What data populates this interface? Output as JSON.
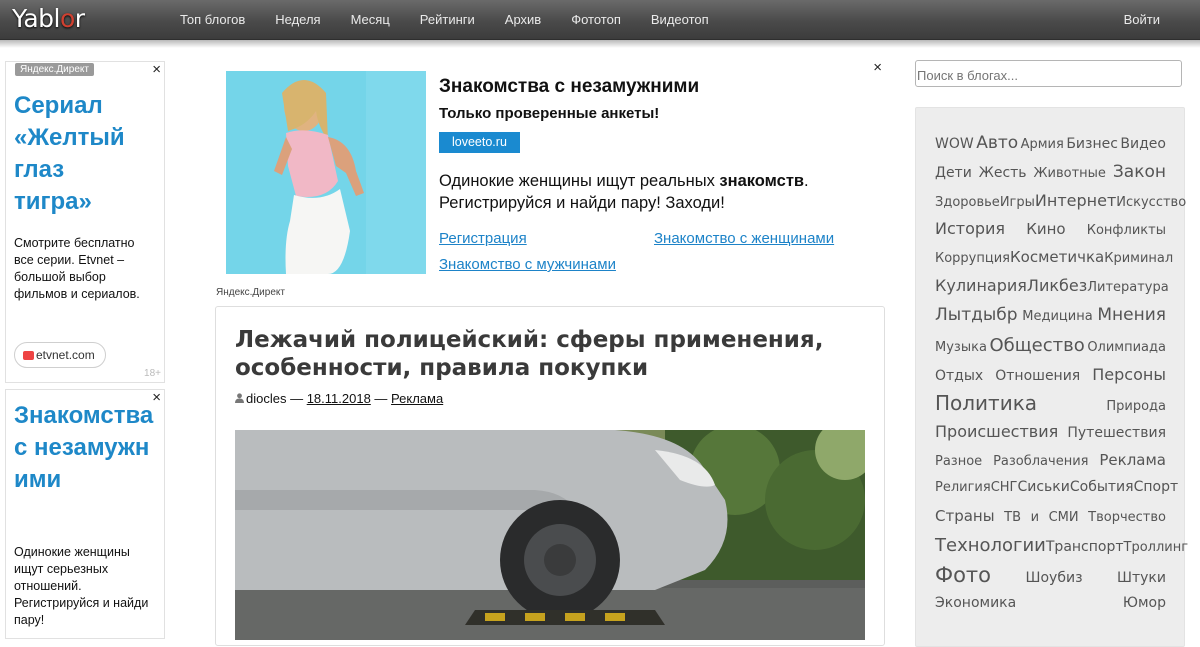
{
  "header": {
    "logo": "Yablor",
    "nav": [
      "Топ блогов",
      "Неделя",
      "Месяц",
      "Рейтинги",
      "Архив",
      "Фототоп",
      "Видеотоп"
    ],
    "login": "Войти"
  },
  "ad_left_1": {
    "label": "Яндекс.Директ",
    "close": "×",
    "title": "Сериал «Желтый глаз тигра»",
    "text": "Смотрите бесплатно все серии. Etvnet – большой выбор фильмов и сериалов.",
    "domain": "etvnet.com",
    "age": "18+"
  },
  "ad_left_2": {
    "close": "×",
    "title": "Знакомства с незамужними",
    "text": "Одинокие женщины ищут серьезных отношений. Регистрируйся и найди пару!"
  },
  "direct_ad": {
    "close": "×",
    "title": "Знакомства с незамужними",
    "subtitle": "Только проверенные анкеты!",
    "button": "loveeto.ru",
    "text_pre": "Одинокие женщины ищут реальных ",
    "text_bold": "знакомств",
    "text_post": ". Регистрируйся и найди пару! Заходи!",
    "links": [
      "Регистрация",
      "Знакомство с женщинами",
      "Знакомство с мужчинами"
    ],
    "label": "Яндекс.Директ"
  },
  "article": {
    "title": "Лежачий полицейский: сферы применения, особенности, правила покупки",
    "author": "diocles",
    "sep1": " — ",
    "date": "18.11.2018",
    "sep2": " — ",
    "category": "Реклама"
  },
  "search": {
    "placeholder": "Поиск в блогах..."
  },
  "tags": [
    [
      {
        "t": "WOW",
        "s": 14
      },
      {
        "t": "Авто",
        "s": 17
      },
      {
        "t": "Армия",
        "s": 13
      },
      {
        "t": "Бизнес",
        "s": 14
      },
      {
        "t": "Видео",
        "s": 14
      }
    ],
    [
      {
        "t": "Дети",
        "s": 14
      },
      {
        "t": "Жесть",
        "s": 14
      },
      {
        "t": "Животные",
        "s": 13
      },
      {
        "t": "Закон",
        "s": 17
      }
    ],
    [
      {
        "t": "Здоровье",
        "s": 13
      },
      {
        "t": "Игры",
        "s": 13
      },
      {
        "t": "Интернет",
        "s": 16
      },
      {
        "t": "Искусство",
        "s": 13
      }
    ],
    [
      {
        "t": "История",
        "s": 16
      },
      {
        "t": "Кино",
        "s": 15
      },
      {
        "t": "Конфликты",
        "s": 13
      }
    ],
    [
      {
        "t": "Коррупция",
        "s": 13
      },
      {
        "t": "Косметичка",
        "s": 15
      },
      {
        "t": "Криминал",
        "s": 13
      }
    ],
    [
      {
        "t": "Кулинария",
        "s": 16
      },
      {
        "t": "Ликбез",
        "s": 16
      },
      {
        "t": "Литература",
        "s": 13
      }
    ],
    [
      {
        "t": "Лытдыбр",
        "s": 17
      },
      {
        "t": "Медицина",
        "s": 13
      },
      {
        "t": "Мнения",
        "s": 17
      }
    ],
    [
      {
        "t": "Музыка",
        "s": 13
      },
      {
        "t": "Общество",
        "s": 18
      },
      {
        "t": "Олимпиада",
        "s": 13
      }
    ],
    [
      {
        "t": "Отдых",
        "s": 14
      },
      {
        "t": "Отношения",
        "s": 14
      },
      {
        "t": "Персоны",
        "s": 16
      }
    ],
    [
      {
        "t": "Политика",
        "s": 20
      },
      {
        "t": "Природа",
        "s": 13
      }
    ],
    [
      {
        "t": "Происшествия",
        "s": 16
      },
      {
        "t": "Путешествия",
        "s": 14
      }
    ],
    [
      {
        "t": "Разное",
        "s": 13
      },
      {
        "t": "Разоблачения",
        "s": 13
      },
      {
        "t": "Реклама",
        "s": 15
      }
    ],
    [
      {
        "t": "Религия",
        "s": 13
      },
      {
        "t": "СНГ",
        "s": 13
      },
      {
        "t": "Сиськи",
        "s": 14
      },
      {
        "t": "События",
        "s": 14
      },
      {
        "t": "Спорт",
        "s": 14
      }
    ],
    [
      {
        "t": "Страны",
        "s": 15
      },
      {
        "t": "ТВ",
        "s": 13
      },
      {
        "t": "и",
        "s": 13
      },
      {
        "t": "СМИ",
        "s": 13
      },
      {
        "t": "Творчество",
        "s": 13
      }
    ],
    [
      {
        "t": "Технологии",
        "s": 18
      },
      {
        "t": "Транспорт",
        "s": 14
      },
      {
        "t": "Троллинг",
        "s": 13
      }
    ],
    [
      {
        "t": "Фото",
        "s": 21
      },
      {
        "t": "Шоубиз",
        "s": 14
      },
      {
        "t": "Штуки",
        "s": 14
      }
    ],
    [
      {
        "t": "Экономика",
        "s": 14
      },
      {
        "t": "Юмор",
        "s": 14
      }
    ]
  ],
  "colors": {
    "accent": "#1e88c8",
    "topbar": "#4a4a4a",
    "tag_text": "#555555"
  }
}
